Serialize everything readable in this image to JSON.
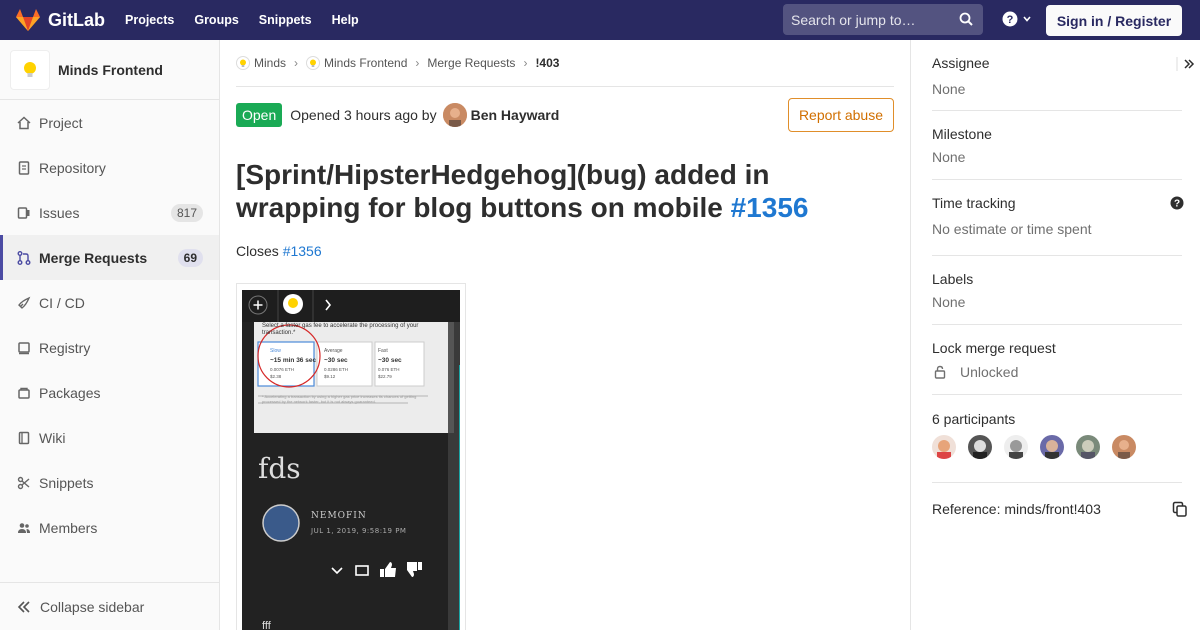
{
  "nav": {
    "brand": "GitLab",
    "links": [
      "Projects",
      "Groups",
      "Snippets",
      "Help"
    ],
    "search_placeholder": "Search or jump to…",
    "signin_label": "Sign in / Register"
  },
  "sidebar": {
    "project_name": "Minds Frontend",
    "items": [
      {
        "label": "Project",
        "icon": "home-icon"
      },
      {
        "label": "Repository",
        "icon": "doc-icon"
      },
      {
        "label": "Issues",
        "icon": "issues-icon",
        "count": "817"
      },
      {
        "label": "Merge Requests",
        "icon": "merge-icon",
        "count": "69"
      },
      {
        "label": "CI / CD",
        "icon": "rocket-icon"
      },
      {
        "label": "Registry",
        "icon": "registry-icon"
      },
      {
        "label": "Packages",
        "icon": "package-icon"
      },
      {
        "label": "Wiki",
        "icon": "book-icon"
      },
      {
        "label": "Snippets",
        "icon": "scissors-icon"
      },
      {
        "label": "Members",
        "icon": "users-icon"
      }
    ],
    "collapse_label": "Collapse sidebar"
  },
  "breadcrumb": {
    "items": [
      "Minds",
      "Minds Frontend",
      "Merge Requests",
      "!403"
    ]
  },
  "mr": {
    "status": "Open",
    "opened_text": "Opened 3 hours ago by",
    "author": "Ben Hayward",
    "report_label": "Report abuse",
    "title": "[Sprint/HipsterHedgehog](bug) added in wrapping for blog buttons on mobile",
    "title_issue": "#1356",
    "closes_label": "Closes",
    "closes_issue": "#1356"
  },
  "screenshot": {
    "prompt": "Select a faster gas fee to accelerate the processing of your transaction.*",
    "options": [
      {
        "name": "Slow",
        "time": "~15 min 36 sec",
        "eth": "0.0076 ETH",
        "usd": "$2.38"
      },
      {
        "name": "Average",
        "time": "~30 sec",
        "eth": "0.0286 ETH",
        "usd": "$9.12"
      },
      {
        "name": "Fast",
        "time": "~30 sec",
        "eth": "0.076 ETH",
        "usd": "$22.79"
      }
    ],
    "note": "* Accelerating a transaction by using a higher gas price increases its chances of getting processed by the network faster, but it is not always guaranteed.",
    "blog_title": "fds",
    "blog_author": "NEMOFIN",
    "blog_date": "JUL 1, 2019, 9:58:19 PM",
    "blog_body": "fff"
  },
  "right": {
    "assignee_label": "Assignee",
    "assignee_value": "None",
    "milestone_label": "Milestone",
    "milestone_value": "None",
    "time_label": "Time tracking",
    "time_value": "No estimate or time spent",
    "labels_label": "Labels",
    "labels_value": "None",
    "lock_label": "Lock merge request",
    "lock_value": "Unlocked",
    "participants_label": "6 participants",
    "reference_label": "Reference: minds/front!403"
  },
  "colors": {
    "nav_bg": "#292961",
    "open_green": "#1aaa55",
    "link_blue": "#1f78d1",
    "report_orange": "#d16f00"
  }
}
